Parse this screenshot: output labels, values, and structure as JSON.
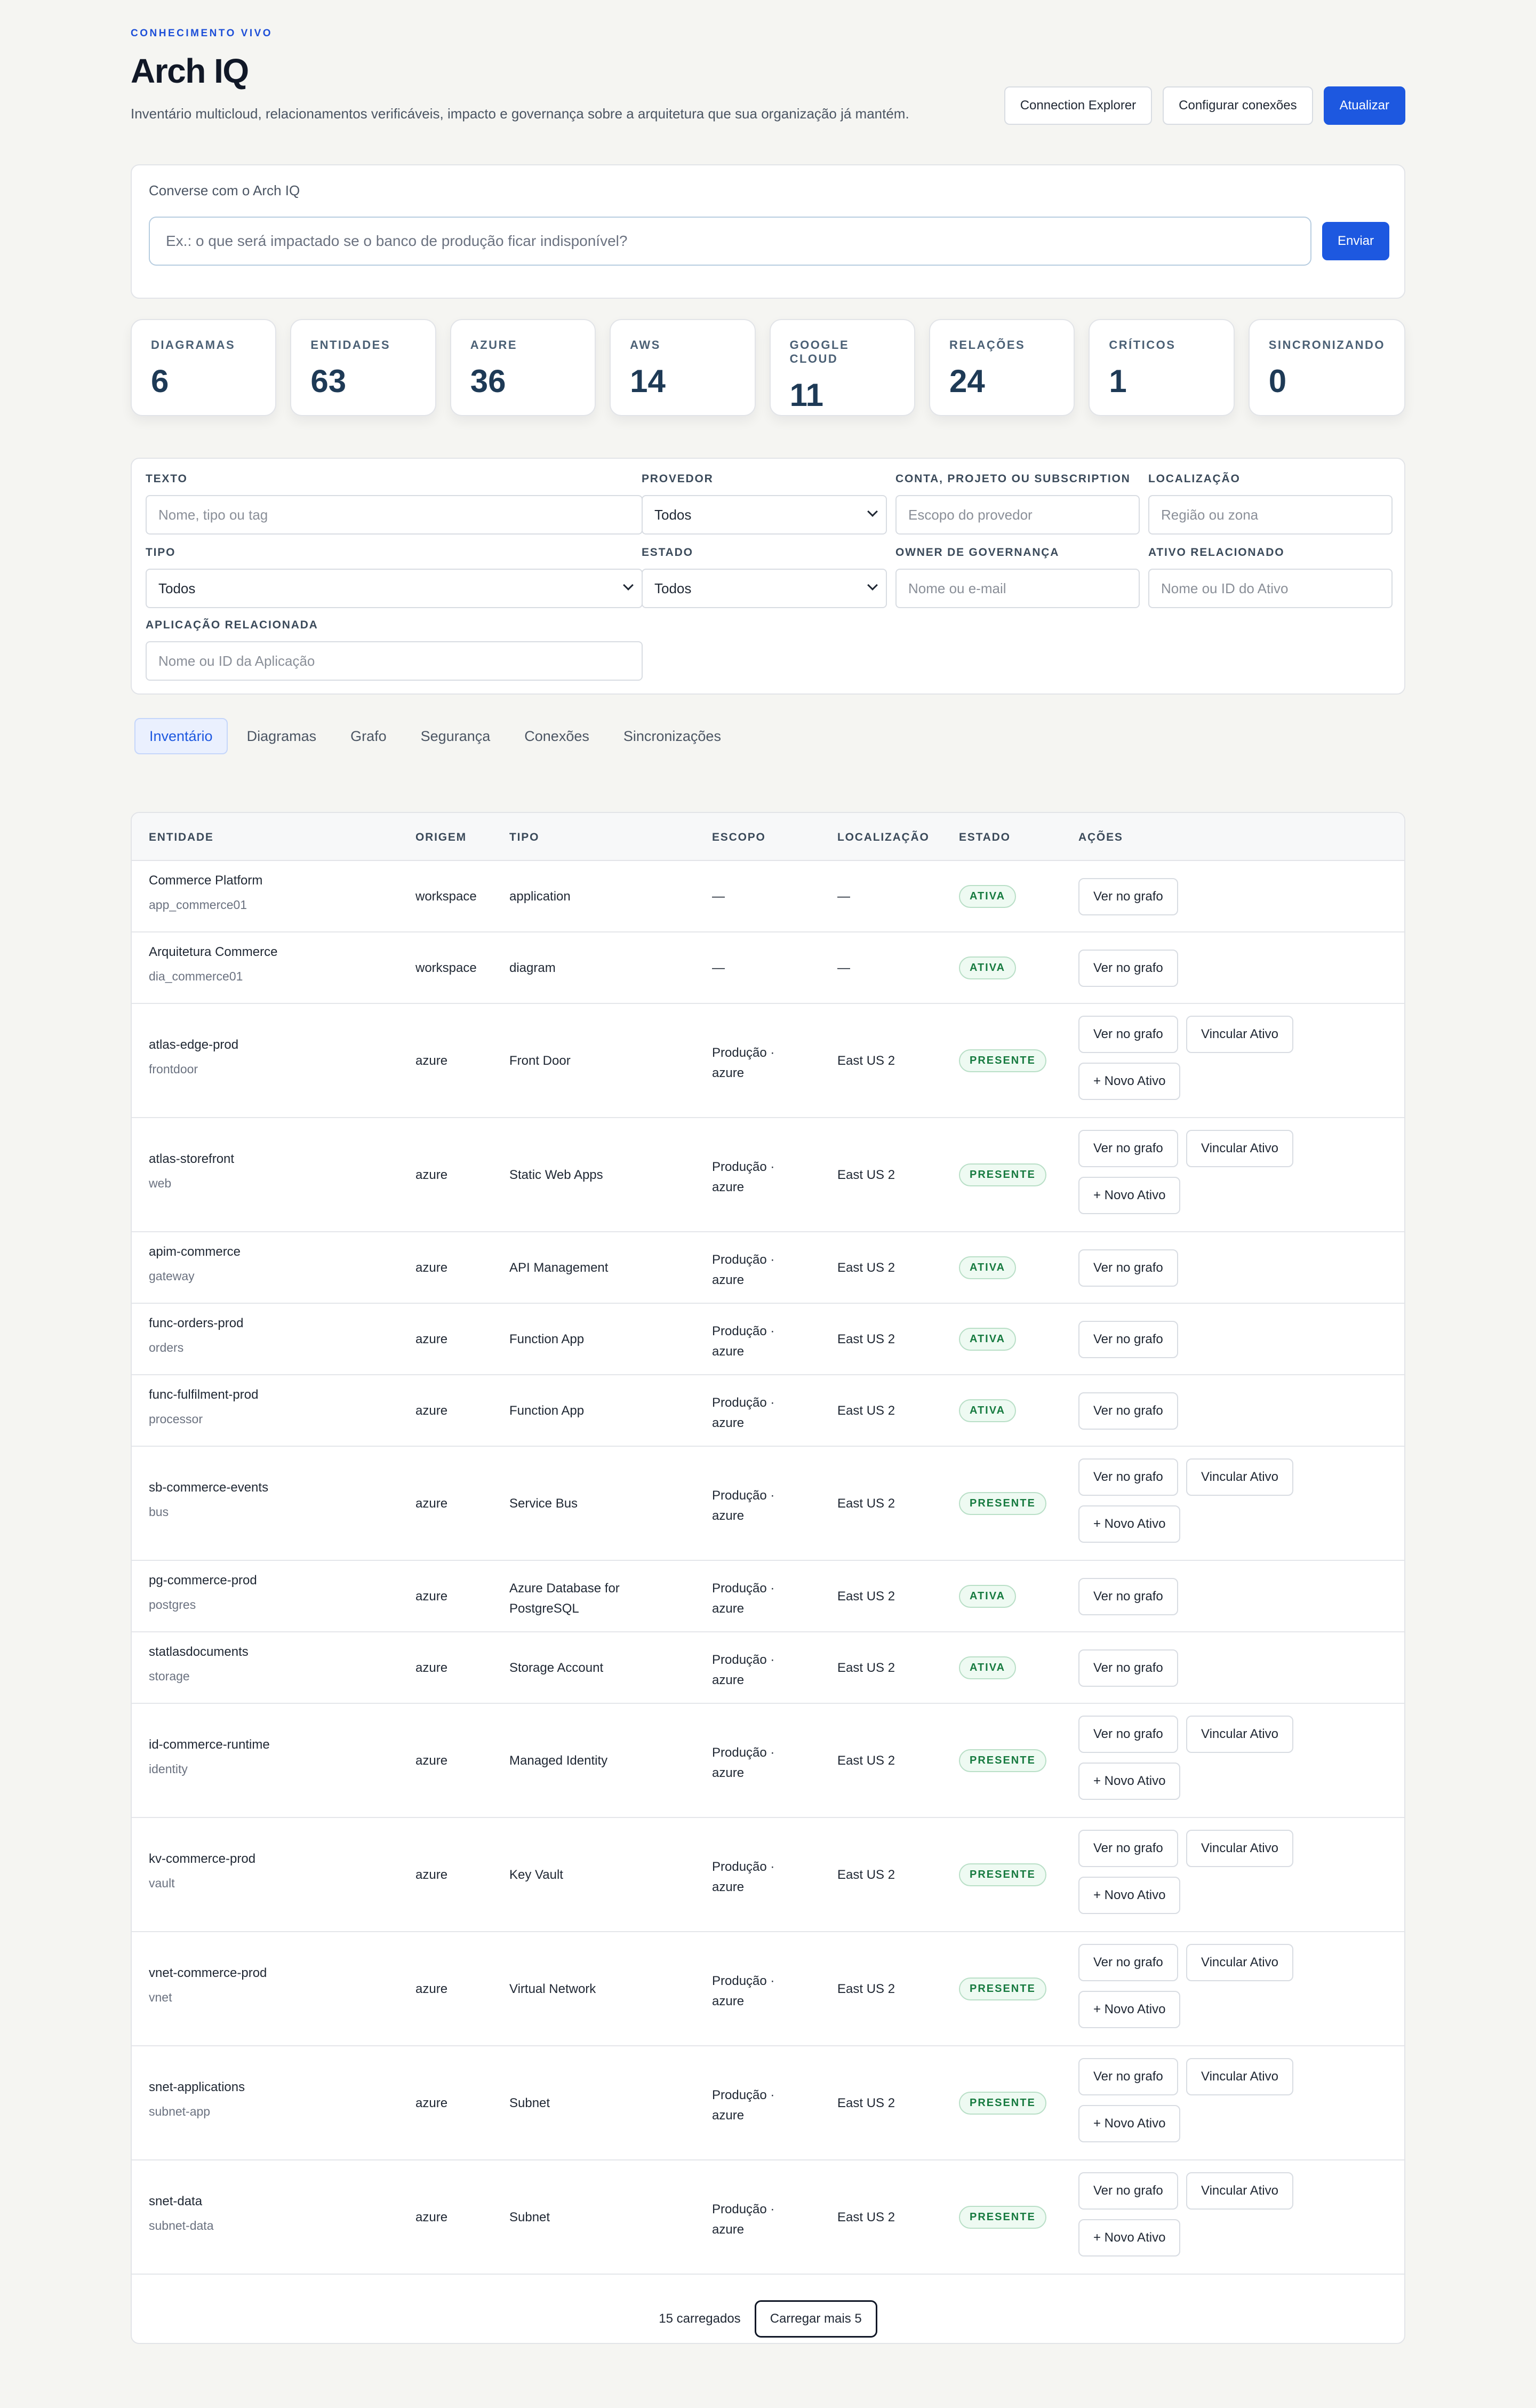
{
  "header": {
    "eyebrow": "CONHECIMENTO VIVO",
    "title": "Arch IQ",
    "subtitle": "Inventário multicloud, relacionamentos verificáveis, impacto e governança sobre a arquitetura que sua organização já mantém.",
    "actions": {
      "connection_explorer": "Connection Explorer",
      "configure": "Configurar conexões",
      "refresh": "Atualizar"
    }
  },
  "chat": {
    "label": "Converse com o Arch IQ",
    "placeholder": "Ex.: o que será impactado se o banco de produção ficar indisponível?",
    "send": "Enviar"
  },
  "stats": [
    {
      "label": "DIAGRAMAS",
      "value": "6"
    },
    {
      "label": "ENTIDADES",
      "value": "63"
    },
    {
      "label": "AZURE",
      "value": "36"
    },
    {
      "label": "AWS",
      "value": "14"
    },
    {
      "label": "GOOGLE CLOUD",
      "value": "11"
    },
    {
      "label": "RELAÇÕES",
      "value": "24"
    },
    {
      "label": "CRÍTICOS",
      "value": "1"
    },
    {
      "label": "SINCRONIZANDO",
      "value": "0"
    }
  ],
  "filters": {
    "text": {
      "label": "Texto",
      "placeholder": "Nome, tipo ou tag"
    },
    "provider": {
      "label": "Provedor",
      "value": "Todos"
    },
    "account": {
      "label": "Conta, projeto ou subscription",
      "placeholder": "Escopo do provedor"
    },
    "location": {
      "label": "Localização",
      "placeholder": "Região ou zona"
    },
    "type": {
      "label": "Tipo",
      "value": "Todos"
    },
    "state": {
      "label": "Estado",
      "value": "Todos"
    },
    "owner": {
      "label": "Owner de governança",
      "placeholder": "Nome ou e-mail"
    },
    "asset": {
      "label": "Ativo relacionado",
      "placeholder": "Nome ou ID do Ativo"
    },
    "application": {
      "label": "Aplicação relacionada",
      "placeholder": "Nome ou ID da Aplicação"
    }
  },
  "tabs": [
    "Inventário",
    "Diagramas",
    "Grafo",
    "Segurança",
    "Conexões",
    "Sincronizações"
  ],
  "table": {
    "columns": {
      "entity": "ENTIDADE",
      "origin": "ORIGEM",
      "type": "TIPO",
      "scope": "ESCOPO",
      "location": "LOCALIZAÇÃO",
      "state": "ESTADO",
      "actions": "AÇÕES"
    },
    "action_labels": {
      "view": "Ver no grafo",
      "link": "Vincular Ativo",
      "new": "+ Novo Ativo"
    },
    "rows": [
      {
        "name": "Commerce Platform",
        "sub": "app_commerce01",
        "origin": "workspace",
        "type": "application",
        "type2": "",
        "scope": "—",
        "scope2": "",
        "location": "—",
        "state": "ATIVA",
        "extended": false
      },
      {
        "name": "Arquitetura Commerce",
        "sub": "dia_commerce01",
        "origin": "workspace",
        "type": "diagram",
        "type2": "",
        "scope": "—",
        "scope2": "",
        "location": "—",
        "state": "ATIVA",
        "extended": false
      },
      {
        "name": "atlas-edge-prod",
        "sub": "frontdoor",
        "origin": "azure",
        "type": "Front Door",
        "type2": "",
        "scope": "Produção ·",
        "scope2": "azure",
        "location": "East US 2",
        "state": "PRESENTE",
        "extended": true
      },
      {
        "name": "atlas-storefront",
        "sub": "web",
        "origin": "azure",
        "type": "Static Web Apps",
        "type2": "",
        "scope": "Produção ·",
        "scope2": "azure",
        "location": "East US 2",
        "state": "PRESENTE",
        "extended": true
      },
      {
        "name": "apim-commerce",
        "sub": "gateway",
        "origin": "azure",
        "type": "API Management",
        "type2": "",
        "scope": "Produção ·",
        "scope2": "azure",
        "location": "East US 2",
        "state": "ATIVA",
        "extended": false
      },
      {
        "name": "func-orders-prod",
        "sub": "orders",
        "origin": "azure",
        "type": "Function App",
        "type2": "",
        "scope": "Produção ·",
        "scope2": "azure",
        "location": "East US 2",
        "state": "ATIVA",
        "extended": false
      },
      {
        "name": "func-fulfilment-prod",
        "sub": "processor",
        "origin": "azure",
        "type": "Function App",
        "type2": "",
        "scope": "Produção ·",
        "scope2": "azure",
        "location": "East US 2",
        "state": "ATIVA",
        "extended": false
      },
      {
        "name": "sb-commerce-events",
        "sub": "bus",
        "origin": "azure",
        "type": "Service Bus",
        "type2": "",
        "scope": "Produção ·",
        "scope2": "azure",
        "location": "East US 2",
        "state": "PRESENTE",
        "extended": true
      },
      {
        "name": "pg-commerce-prod",
        "sub": "postgres",
        "origin": "azure",
        "type": "Azure Database for",
        "type2": "PostgreSQL",
        "scope": "Produção ·",
        "scope2": "azure",
        "location": "East US 2",
        "state": "ATIVA",
        "extended": false
      },
      {
        "name": "statlasdocuments",
        "sub": "storage",
        "origin": "azure",
        "type": "Storage Account",
        "type2": "",
        "scope": "Produção ·",
        "scope2": "azure",
        "location": "East US 2",
        "state": "ATIVA",
        "extended": false
      },
      {
        "name": "id-commerce-runtime",
        "sub": "identity",
        "origin": "azure",
        "type": "Managed Identity",
        "type2": "",
        "scope": "Produção ·",
        "scope2": "azure",
        "location": "East US 2",
        "state": "PRESENTE",
        "extended": true
      },
      {
        "name": "kv-commerce-prod",
        "sub": "vault",
        "origin": "azure",
        "type": "Key Vault",
        "type2": "",
        "scope": "Produção ·",
        "scope2": "azure",
        "location": "East US 2",
        "state": "PRESENTE",
        "extended": true
      },
      {
        "name": "vnet-commerce-prod",
        "sub": "vnet",
        "origin": "azure",
        "type": "Virtual Network",
        "type2": "",
        "scope": "Produção ·",
        "scope2": "azure",
        "location": "East US 2",
        "state": "PRESENTE",
        "extended": true
      },
      {
        "name": "snet-applications",
        "sub": "subnet-app",
        "origin": "azure",
        "type": "Subnet",
        "type2": "",
        "scope": "Produção ·",
        "scope2": "azure",
        "location": "East US 2",
        "state": "PRESENTE",
        "extended": true
      },
      {
        "name": "snet-data",
        "sub": "subnet-data",
        "origin": "azure",
        "type": "Subnet",
        "type2": "",
        "scope": "Produção ·",
        "scope2": "azure",
        "location": "East US 2",
        "state": "PRESENTE",
        "extended": true
      }
    ],
    "footer": {
      "count": "15 carregados",
      "load_more": "Carregar mais 5"
    }
  }
}
